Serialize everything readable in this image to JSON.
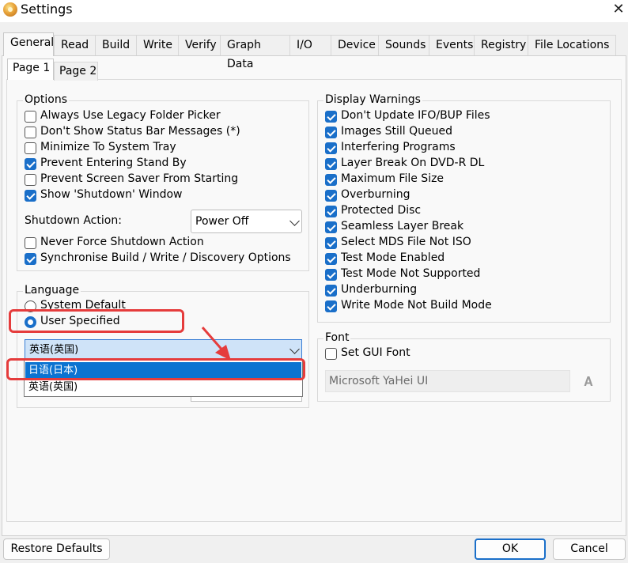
{
  "window": {
    "title": "Settings"
  },
  "tabs": [
    "General",
    "Read",
    "Build",
    "Write",
    "Verify",
    "Graph Data",
    "I/O",
    "Device",
    "Sounds",
    "Events",
    "Registry",
    "File Locations"
  ],
  "subtabs": [
    "Page 1",
    "Page 2"
  ],
  "options": {
    "legend": "Options",
    "items": [
      {
        "label": "Always Use Legacy Folder Picker",
        "checked": false
      },
      {
        "label": "Don't Show Status Bar Messages (*)",
        "checked": false
      },
      {
        "label": "Minimize To System Tray",
        "checked": false
      },
      {
        "label": "Prevent Entering Stand By",
        "checked": true
      },
      {
        "label": "Prevent Screen Saver From Starting",
        "checked": false
      },
      {
        "label": "Show 'Shutdown' Window",
        "checked": true
      }
    ],
    "shutdown_label": "Shutdown Action:",
    "shutdown_value": "Power Off",
    "extra_items": [
      {
        "label": "Never Force Shutdown Action",
        "checked": false
      },
      {
        "label": "Synchronise Build / Write / Discovery Options",
        "checked": true
      }
    ]
  },
  "language": {
    "legend": "Language",
    "radio_system": "System Default",
    "radio_user": "User Specified",
    "selected_value": "英语(英国)",
    "dropdown_items": [
      "日语(日本)",
      "英语(英国)"
    ]
  },
  "display_warnings": {
    "legend": "Display Warnings",
    "items": [
      {
        "label": "Don't Update IFO/BUP Files",
        "checked": true
      },
      {
        "label": "Images Still Queued",
        "checked": true
      },
      {
        "label": "Interfering Programs",
        "checked": true
      },
      {
        "label": "Layer Break On DVD-R DL",
        "checked": true
      },
      {
        "label": "Maximum File Size",
        "checked": true
      },
      {
        "label": "Overburning",
        "checked": true
      },
      {
        "label": "Protected Disc",
        "checked": true
      },
      {
        "label": "Seamless Layer Break",
        "checked": true
      },
      {
        "label": "Select MDS File Not ISO",
        "checked": true
      },
      {
        "label": "Test Mode Enabled",
        "checked": true
      },
      {
        "label": "Test Mode Not Supported",
        "checked": true
      },
      {
        "label": "Underburning",
        "checked": true
      },
      {
        "label": "Write Mode Not Build Mode",
        "checked": true
      }
    ]
  },
  "font": {
    "legend": "Font",
    "set_gui_font_label": "Set GUI Font",
    "set_gui_font_checked": false,
    "font_value": "Microsoft YaHei UI"
  },
  "buttons": {
    "restore": "Restore Defaults",
    "ok": "OK",
    "cancel": "Cancel"
  },
  "colors": {
    "accent": "#1a6fc9",
    "highlight": "#0b73d1",
    "annotation_red": "#e53c3c"
  }
}
